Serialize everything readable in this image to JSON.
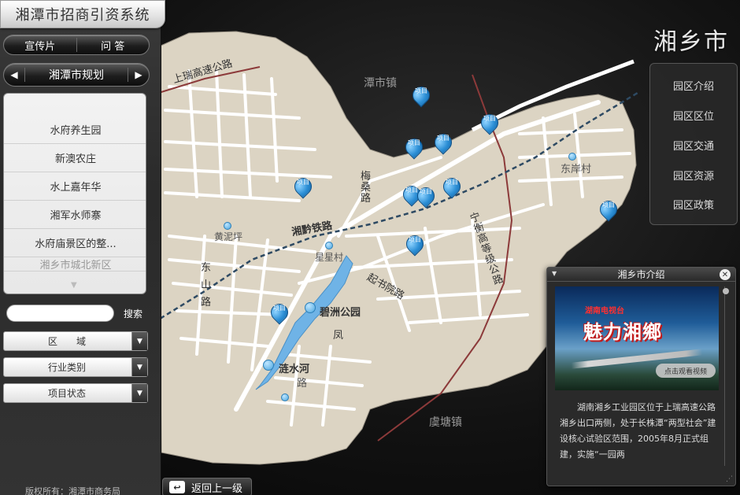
{
  "app": {
    "title": "湘潭市招商引资系统"
  },
  "sidebar": {
    "top_buttons": [
      "宣传片",
      "问 答"
    ],
    "plan": {
      "prev_icon": "left-triangle",
      "label": "湘潭市规划",
      "next_icon": "right-triangle"
    },
    "list_items": [
      "水府养生园",
      "新澳农庄",
      "水上嘉年华",
      "湘军水师寨",
      "水府庙景区的整...",
      "湘乡市城北新区"
    ],
    "search": {
      "value": "",
      "button": "搜索"
    },
    "filters": [
      "区　　域",
      "行业类别",
      "项目状态"
    ],
    "copyright": "版权所有：湘潭市商务局"
  },
  "map": {
    "towns": [
      "潭市镇",
      "虞塘镇"
    ],
    "roads": [
      "上瑞高速公路",
      "湘黔铁路",
      "宁衡高等级公路",
      "梅桑路",
      "东山路",
      "起书院路",
      "凤"
    ],
    "places": [
      "东岸村",
      "黄泥坪",
      "星星村",
      "碧洲公园",
      "涟水河",
      "路"
    ],
    "pin_label": "项目",
    "pin_count": 13,
    "colors": {
      "land": "#dcd4c3",
      "road": "#ffffff",
      "river": "#6fb3e6",
      "rail": "#2e4a63",
      "highway_accent": "#8c3a3a",
      "pin": "#2c8fd6"
    }
  },
  "city": {
    "name": "湘乡市"
  },
  "park_menu": [
    "园区介绍",
    "园区区位",
    "园区交通",
    "园区资源",
    "园区政策"
  ],
  "intro": {
    "title": "湘乡市介绍",
    "video_top": "湖南电视台",
    "video_title": "魅力湘鄉",
    "video_button": "点击观看视频",
    "text": "湖南湘乡工业园区位于上瑞高速公路湘乡出口两侧，处于长株潭“两型社会”建设核心试验区范围，2005年8月正式组建，实施“一园两"
  },
  "back_button": {
    "label": "返回上一级"
  }
}
